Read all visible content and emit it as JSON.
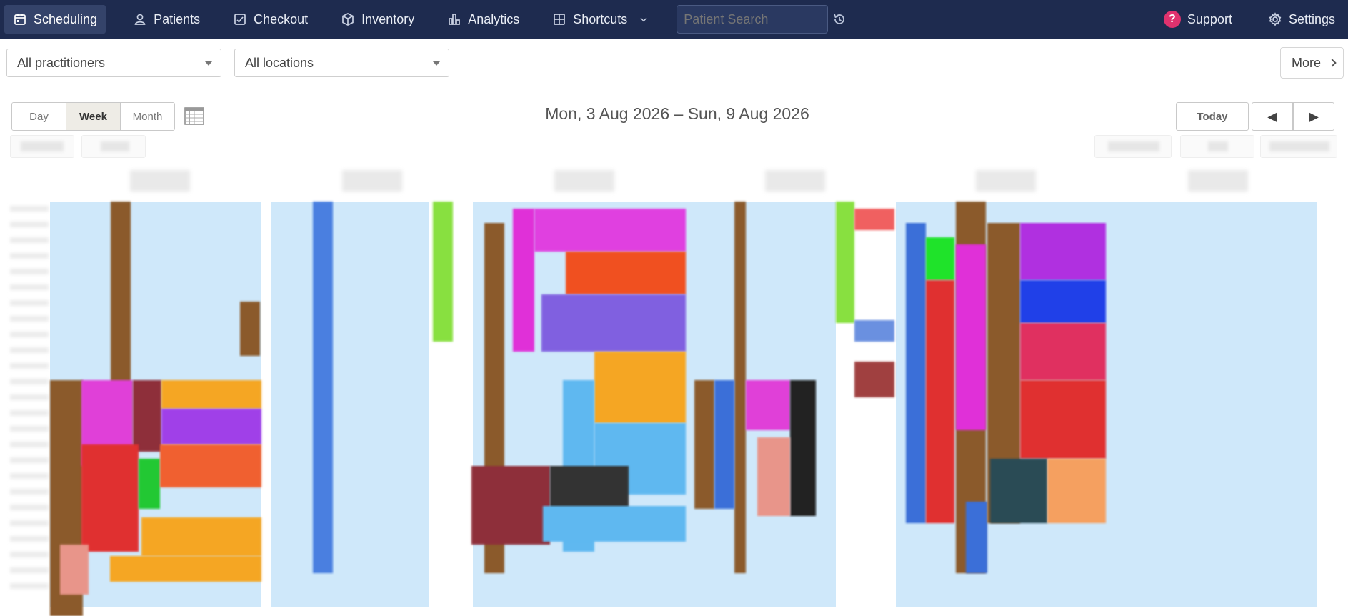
{
  "nav": {
    "items": [
      {
        "label": "Scheduling",
        "icon": "calendar-icon",
        "active": true
      },
      {
        "label": "Patients",
        "icon": "person-icon"
      },
      {
        "label": "Checkout",
        "icon": "checkout-icon"
      },
      {
        "label": "Inventory",
        "icon": "box-icon"
      },
      {
        "label": "Analytics",
        "icon": "bar-chart-icon"
      },
      {
        "label": "Shortcuts",
        "icon": "grid-icon"
      }
    ],
    "search_placeholder": "Patient Search",
    "support_label": "Support",
    "support_badge": "?",
    "settings_label": "Settings"
  },
  "filters": {
    "practitioners": "All practitioners",
    "locations": "All locations",
    "more": "More"
  },
  "toolbar": {
    "views": [
      "Day",
      "Week",
      "Month"
    ],
    "active_view": "Week",
    "date_range": "Mon, 3 Aug 2026 – Sun, 9 Aug 2026",
    "today": "Today",
    "prev": "◀",
    "next": "▶"
  },
  "colors": {
    "nav_bg": "#1e2b4f",
    "calendar_bg": "#cfe8fa",
    "support_badge": "#e0326e"
  }
}
